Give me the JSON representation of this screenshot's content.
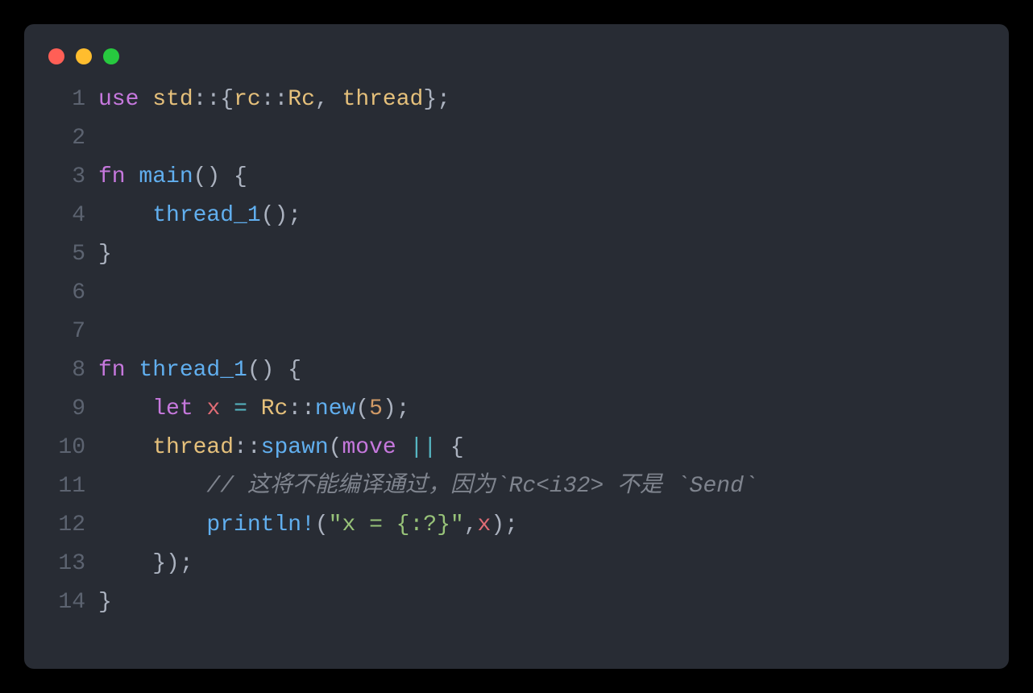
{
  "window": {
    "traffic_lights": [
      "close",
      "minimize",
      "zoom"
    ]
  },
  "code": {
    "lines": [
      {
        "n": "1",
        "tokens": [
          {
            "c": "tk-keyword",
            "t": "use"
          },
          {
            "c": "tk-punct",
            "t": " "
          },
          {
            "c": "tk-ident",
            "t": "std"
          },
          {
            "c": "tk-punct",
            "t": "::{"
          },
          {
            "c": "tk-ident",
            "t": "rc"
          },
          {
            "c": "tk-punct",
            "t": "::"
          },
          {
            "c": "tk-type",
            "t": "Rc"
          },
          {
            "c": "tk-punct",
            "t": ", "
          },
          {
            "c": "tk-ident",
            "t": "thread"
          },
          {
            "c": "tk-punct",
            "t": "};"
          }
        ]
      },
      {
        "n": "2",
        "tokens": []
      },
      {
        "n": "3",
        "tokens": [
          {
            "c": "tk-keyword",
            "t": "fn"
          },
          {
            "c": "tk-punct",
            "t": " "
          },
          {
            "c": "tk-fndef",
            "t": "main"
          },
          {
            "c": "tk-punct",
            "t": "() {"
          }
        ]
      },
      {
        "n": "4",
        "tokens": [
          {
            "c": "tk-punct",
            "t": "    "
          },
          {
            "c": "tk-func",
            "t": "thread_1"
          },
          {
            "c": "tk-punct",
            "t": "();"
          }
        ]
      },
      {
        "n": "5",
        "tokens": [
          {
            "c": "tk-punct",
            "t": "}"
          }
        ]
      },
      {
        "n": "6",
        "tokens": []
      },
      {
        "n": "7",
        "tokens": []
      },
      {
        "n": "8",
        "tokens": [
          {
            "c": "tk-keyword",
            "t": "fn"
          },
          {
            "c": "tk-punct",
            "t": " "
          },
          {
            "c": "tk-fndef",
            "t": "thread_1"
          },
          {
            "c": "tk-punct",
            "t": "() {"
          }
        ]
      },
      {
        "n": "9",
        "tokens": [
          {
            "c": "tk-punct",
            "t": "    "
          },
          {
            "c": "tk-keyword",
            "t": "let"
          },
          {
            "c": "tk-punct",
            "t": " "
          },
          {
            "c": "tk-var",
            "t": "x"
          },
          {
            "c": "tk-punct",
            "t": " "
          },
          {
            "c": "tk-op",
            "t": "="
          },
          {
            "c": "tk-punct",
            "t": " "
          },
          {
            "c": "tk-type",
            "t": "Rc"
          },
          {
            "c": "tk-punct",
            "t": "::"
          },
          {
            "c": "tk-func",
            "t": "new"
          },
          {
            "c": "tk-punct",
            "t": "("
          },
          {
            "c": "tk-num",
            "t": "5"
          },
          {
            "c": "tk-punct",
            "t": ");"
          }
        ]
      },
      {
        "n": "10",
        "tokens": [
          {
            "c": "tk-punct",
            "t": "    "
          },
          {
            "c": "tk-ident",
            "t": "thread"
          },
          {
            "c": "tk-punct",
            "t": "::"
          },
          {
            "c": "tk-func",
            "t": "spawn"
          },
          {
            "c": "tk-punct",
            "t": "("
          },
          {
            "c": "tk-keyword",
            "t": "move"
          },
          {
            "c": "tk-punct",
            "t": " "
          },
          {
            "c": "tk-op",
            "t": "||"
          },
          {
            "c": "tk-punct",
            "t": " {"
          }
        ]
      },
      {
        "n": "11",
        "tokens": [
          {
            "c": "tk-punct",
            "t": "        "
          },
          {
            "c": "tk-comment",
            "t": "// 这将不能编译通过，因为`Rc<i32> 不是 `Send`"
          }
        ]
      },
      {
        "n": "12",
        "tokens": [
          {
            "c": "tk-punct",
            "t": "        "
          },
          {
            "c": "tk-func",
            "t": "println!"
          },
          {
            "c": "tk-punct",
            "t": "("
          },
          {
            "c": "tk-string",
            "t": "\"x = {:?}\""
          },
          {
            "c": "tk-punct",
            "t": ","
          },
          {
            "c": "tk-var",
            "t": "x"
          },
          {
            "c": "tk-punct",
            "t": ");"
          }
        ]
      },
      {
        "n": "13",
        "tokens": [
          {
            "c": "tk-punct",
            "t": "    });"
          }
        ]
      },
      {
        "n": "14",
        "tokens": [
          {
            "c": "tk-punct",
            "t": "}"
          }
        ]
      }
    ]
  }
}
